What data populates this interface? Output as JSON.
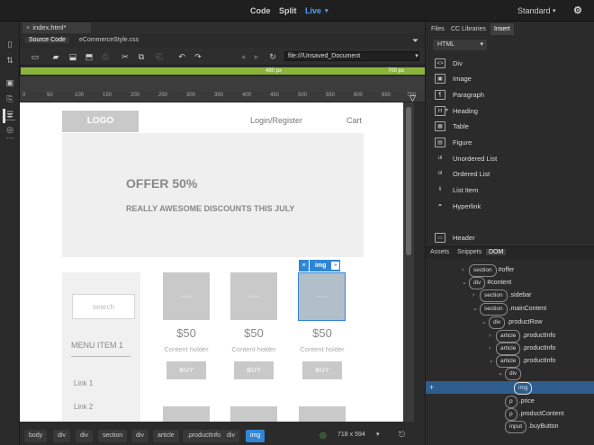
{
  "app": {
    "code_label": "Code",
    "split_label": "Split",
    "live_label": "Live",
    "workspace": "Standard"
  },
  "document": {
    "filename": "index.html*"
  },
  "related_files": [
    {
      "label": "Source Code",
      "active": true
    },
    {
      "label": "eCommerceStyle.css",
      "active": false
    }
  ],
  "address": {
    "value": "file:///Unsaved_Document"
  },
  "viewport": {
    "mid_label": "480 px",
    "right_label": "700 px",
    "bar_color": "#8ab43a"
  },
  "ruler_ticks": [
    "0",
    "50",
    "100",
    "150",
    "200",
    "250",
    "300",
    "350",
    "400",
    "450",
    "500",
    "550",
    "600",
    "650",
    "700"
  ],
  "page": {
    "logo": "LOGO",
    "nav_login": "Login/Register",
    "nav_cart": "Cart",
    "hero_title": "OFFER 50%",
    "hero_subtitle": "REALLY AWESOME DISCOUNTS THIS JULY",
    "search_placeholder": "search",
    "menu_item": "MENU ITEM 1",
    "links": [
      "Link 1",
      "Link 2"
    ],
    "products": [
      {
        "price": "$50",
        "holder": "Content holder",
        "buy": "BUY"
      },
      {
        "price": "$50",
        "holder": "Content holder",
        "buy": "BUY"
      },
      {
        "price": "$50",
        "holder": "Content holder",
        "buy": "BUY"
      }
    ],
    "selection_badge": "img"
  },
  "breadcrumbs": [
    "body",
    "div",
    "div",
    "section",
    "div",
    "article",
    ".productInfo",
    "div",
    "img"
  ],
  "status": {
    "dimensions": "718 x 594"
  },
  "panel": {
    "tabs": [
      {
        "label": "Files"
      },
      {
        "label": "CC Libraries"
      },
      {
        "label": "Insert",
        "active": true
      }
    ],
    "category": "HTML",
    "insert_items": [
      {
        "label": "Div",
        "icon": "div-icon",
        "glyph": "<>"
      },
      {
        "label": "Image",
        "icon": "image-icon",
        "glyph": "▣"
      },
      {
        "label": "Paragraph",
        "icon": "paragraph-icon",
        "glyph": "¶"
      },
      {
        "label": "Heading",
        "icon": "heading-icon",
        "glyph": "H"
      },
      {
        "label": "Table",
        "icon": "table-icon",
        "glyph": "▦"
      },
      {
        "label": "Figure",
        "icon": "figure-icon",
        "glyph": "▤"
      },
      {
        "label": "Unordered List",
        "icon": "unordered-list-icon",
        "glyph": "ul"
      },
      {
        "label": "Ordered List",
        "icon": "ordered-list-icon",
        "glyph": "ol"
      },
      {
        "label": "List Item",
        "icon": "list-item-icon",
        "glyph": "li"
      },
      {
        "label": "Hyperlink",
        "icon": "hyperlink-icon",
        "glyph": "⚭"
      },
      {
        "label": "Header",
        "icon": "header-icon",
        "glyph": "▭"
      }
    ],
    "dom_tabs": [
      {
        "label": "Assets"
      },
      {
        "label": "Snippets"
      },
      {
        "label": "DOM",
        "active": true
      }
    ],
    "dom_nodes": [
      {
        "tag": "section",
        "text": "#offer",
        "toggle": "›"
      },
      {
        "tag": "div",
        "text": "#content",
        "toggle": "⌄"
      },
      {
        "tag": "section",
        "text": ".sidebar",
        "toggle": "›"
      },
      {
        "tag": "section",
        "text": ".mainContent",
        "toggle": "⌄"
      },
      {
        "tag": "div",
        "text": ".productRow",
        "toggle": "⌄"
      },
      {
        "tag": "article",
        "text": ".productInfo",
        "toggle": "›"
      },
      {
        "tag": "article",
        "text": ".productInfo",
        "toggle": "›"
      },
      {
        "tag": "article",
        "text": ".productInfo",
        "toggle": "⌄"
      },
      {
        "tag": "div",
        "text": "",
        "toggle": "⌄"
      },
      {
        "tag": "img",
        "text": "",
        "toggle": ""
      },
      {
        "tag": "p",
        "text": ".price",
        "toggle": ""
      },
      {
        "tag": "p",
        "text": ".productContent",
        "toggle": ""
      },
      {
        "tag": "input",
        "text": ".buyButton",
        "toggle": ""
      }
    ]
  }
}
